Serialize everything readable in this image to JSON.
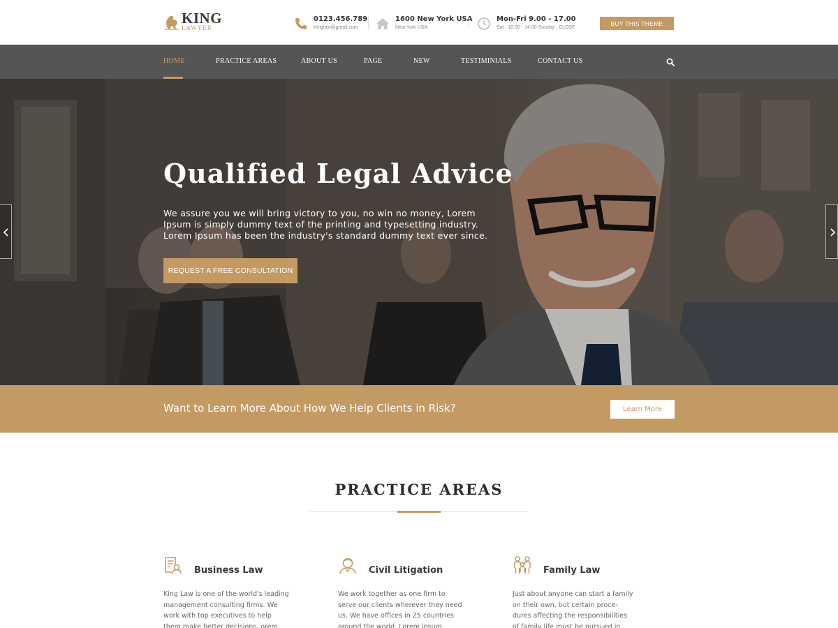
{
  "brand": {
    "name": "KING",
    "tagline": "LAWYER",
    "accent": "#c49a63",
    "nav_bg": "#555555"
  },
  "header": {
    "phone": {
      "main": "0123.456.789",
      "sub": "Kinglaw@gmail.com",
      "icon": "phone-icon"
    },
    "address": {
      "main": "1600 New York USA",
      "sub": "New York USA",
      "icon": "home-icon"
    },
    "hours": {
      "main": "Mon-Fri 9.00 - 17.00",
      "sub": "Sat : 10.00 - 14.00  Sunday : CLOSE",
      "icon": "clock-icon"
    },
    "buy_label": "BUY THIS THEME"
  },
  "nav": {
    "items": [
      {
        "label": "HOME",
        "active": true
      },
      {
        "label": "PRACTICE AREAS"
      },
      {
        "label": "ABOUT US"
      },
      {
        "label": "PAGE"
      },
      {
        "label": "NEW"
      },
      {
        "label": "TESTIMINIALS"
      },
      {
        "label": "CONTACT US"
      }
    ],
    "search_icon": "search-icon"
  },
  "hero": {
    "title": "Qualified Legal Advice",
    "lines": [
      "We assure you we will bring victory to you, no win no money, Lorem",
      "Ipsum is simply dummy text of the printing and typesetting industry.",
      "Lorem Ipsum has been the industry's standard dummy text ever since."
    ],
    "cta_label": "REQUEST A FREE CONSULTATION"
  },
  "cta": {
    "text": "Want to Learn More About How We Help Clients in Risk?",
    "button": "Learn More"
  },
  "practice": {
    "title": "PRACTICE AREAS",
    "cards": [
      {
        "title": "Business Law",
        "icon": "document-person-icon",
        "lines": [
          "King Law is one of the world's leading",
          "management consulting firms. We",
          "work with top executives to help",
          "them make better decisions, orem"
        ]
      },
      {
        "title": "Civil Litigation",
        "icon": "person-icon",
        "lines": [
          "We work together as one firm to",
          "serve our clients wherever they need",
          "us. We have offices in 25 countries",
          "around the world. Lorem ipsum"
        ]
      },
      {
        "title": "Family Law",
        "icon": "family-icon",
        "lines": [
          "Just about anyone can start a family",
          "on their own, but certain proce-",
          "dures affecting the responsibilities",
          "of family life must be pursued in"
        ]
      }
    ]
  }
}
